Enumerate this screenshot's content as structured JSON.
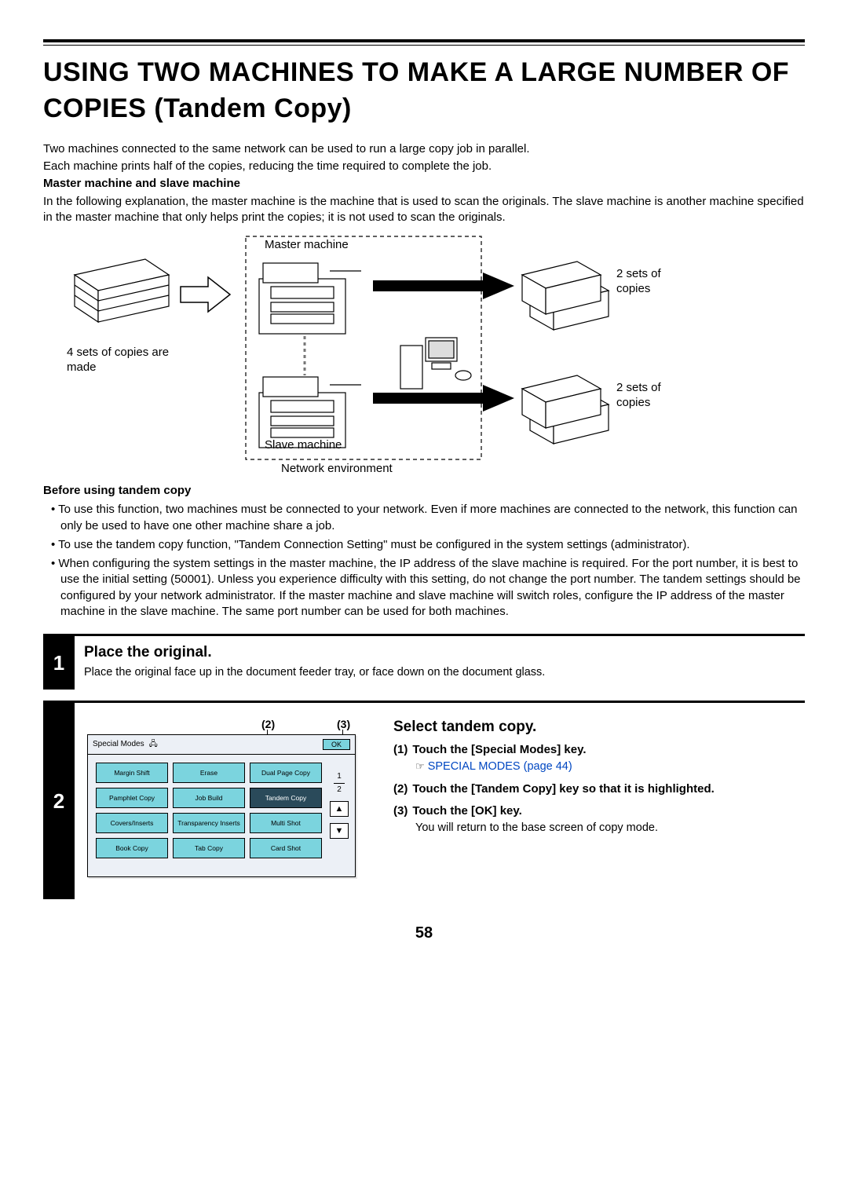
{
  "title": "USING TWO MACHINES TO MAKE A LARGE NUMBER OF COPIES (Tandem Copy)",
  "intro": {
    "p1": "Two machines connected to the same network can be used to run a large copy job in parallel.",
    "p2": "Each machine prints half of the copies, reducing the time required to complete the job.",
    "sub1_head": "Master machine and slave machine",
    "sub1_text": "In the following explanation, the master machine is the machine that is used to scan the originals. The slave machine is another machine specified in the master machine that only helps print the copies; it is not used to scan the originals."
  },
  "diagram": {
    "left_caption": "4 sets of copies are made",
    "master_label": "Master machine",
    "slave_label": "Slave machine",
    "network_label": "Network environment",
    "right_top": "2 sets of copies",
    "right_bottom": "2 sets of copies"
  },
  "before": {
    "head": "Before using tandem copy",
    "b1": "To use this function, two machines must be connected to your network. Even if more machines are connected to the network, this function can only be used to have one other machine share a job.",
    "b2": "To use the tandem copy function, \"Tandem Connection Setting\" must be configured in the system settings (administrator).",
    "b3": "When configuring the system settings in the master machine, the IP address of the slave machine is required. For the port number, it is best to use the initial setting (50001). Unless you experience difficulty with this setting, do not change the port number. The tandem settings should be configured by your network administrator. If the master machine and slave machine will switch roles, configure the IP address of the master machine in the slave machine. The same port number can be used for both machines."
  },
  "step1": {
    "num": "1",
    "title": "Place the original.",
    "text": "Place the original face up in the document feeder tray, or face down on the document glass."
  },
  "step2": {
    "num": "2",
    "markers": {
      "m2": "(2)",
      "m3": "(3)"
    },
    "panel": {
      "header": "Special Modes",
      "ok": "OK",
      "page_indicator": {
        "top": "1",
        "bottom": "2"
      },
      "btns": [
        "Margin Shift",
        "Erase",
        "Dual Page Copy",
        "Pamphlet Copy",
        "Job Build",
        "Tandem Copy",
        "Covers/Inserts",
        "Transparency Inserts",
        "Multi Shot",
        "Book Copy",
        "Tab Copy",
        "Card Shot"
      ]
    },
    "title": "Select tandem copy.",
    "ss1_num": "(1)",
    "ss1_head": "Touch the [Special Modes] key.",
    "ss1_link_icon": "☞",
    "ss1_link": "SPECIAL MODES (page 44)",
    "ss2_num": "(2)",
    "ss2_head": "Touch the [Tandem Copy] key so that it is highlighted.",
    "ss3_num": "(3)",
    "ss3_head": "Touch the [OK] key.",
    "ss3_text": "You will return to the base screen of copy mode."
  },
  "page_number": "58"
}
